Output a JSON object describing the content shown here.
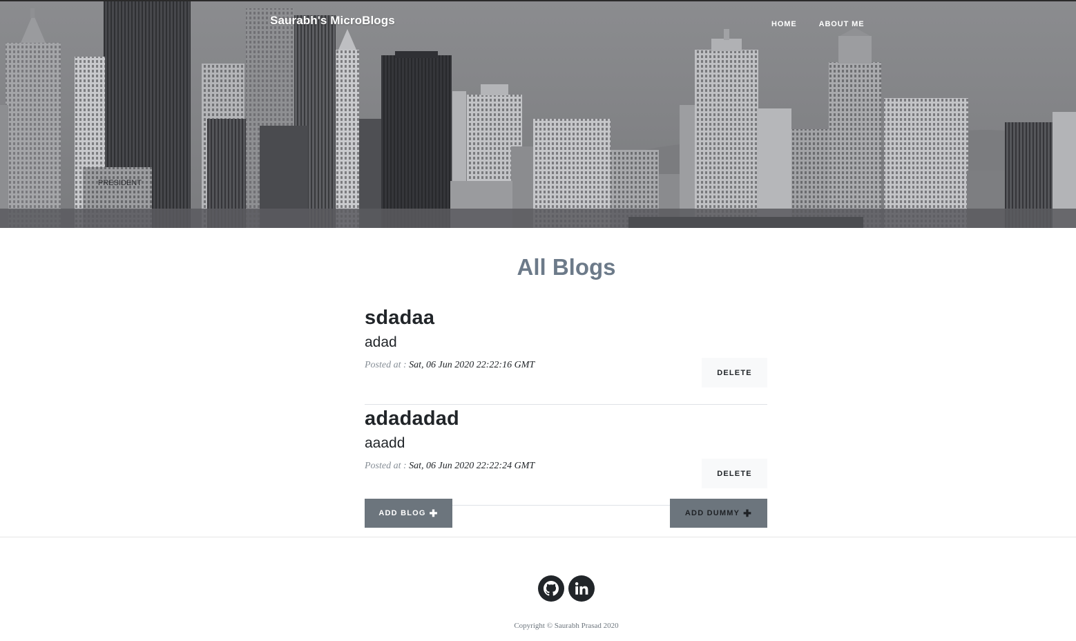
{
  "header": {
    "brand": "Saurabh's MicroBlogs",
    "nav": [
      {
        "label": "HOME"
      },
      {
        "label": "ABOUT ME"
      }
    ],
    "background_sign_text": "PRESIDENT"
  },
  "main": {
    "heading": "All Blogs",
    "posts": [
      {
        "title": "sdadaa",
        "body": "adad",
        "meta_label": "Posted at :",
        "date": "Sat, 06 Jun 2020 22:22:16 GMT",
        "delete_label": "DELETE"
      },
      {
        "title": "adadadad",
        "body": "aaadd",
        "meta_label": "Posted at :",
        "date": "Sat, 06 Jun 2020 22:22:24 GMT",
        "delete_label": "DELETE"
      }
    ],
    "add_blog_label": "ADD BLOG",
    "add_dummy_label": "ADD DUMMY",
    "button_icon": "plus-icon"
  },
  "footer": {
    "social": [
      {
        "icon": "github-icon"
      },
      {
        "icon": "linkedin-icon"
      }
    ],
    "copyright": "Copyright © Saurabh Prasad 2020"
  },
  "colors": {
    "heading": "#6c7a89",
    "button_grey": "#6c757d",
    "button_light": "#f8f9fa",
    "text_dark": "#212529",
    "meta_grey": "#868e96"
  }
}
